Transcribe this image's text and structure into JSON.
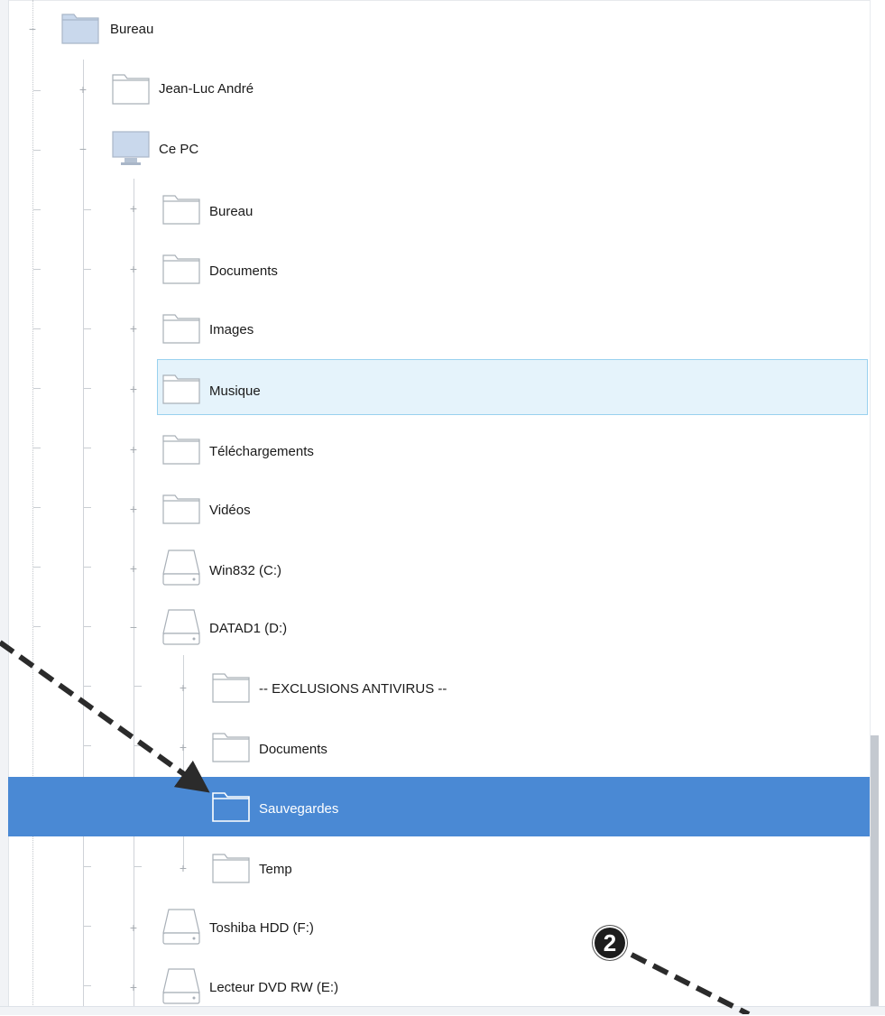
{
  "tree": {
    "items": [
      {
        "label": "Bureau",
        "icon": "folder-icon"
      },
      {
        "label": "Jean-Luc André",
        "icon": "folder-icon"
      },
      {
        "label": "Ce PC",
        "icon": "computer-icon"
      },
      {
        "label": "Bureau",
        "icon": "folder-icon"
      },
      {
        "label": "Documents",
        "icon": "folder-icon"
      },
      {
        "label": "Images",
        "icon": "folder-icon"
      },
      {
        "label": "Musique",
        "icon": "folder-icon"
      },
      {
        "label": "Téléchargements",
        "icon": "folder-icon"
      },
      {
        "label": "Vidéos",
        "icon": "folder-icon"
      },
      {
        "label": "Win832 (C:)",
        "icon": "drive-icon"
      },
      {
        "label": "DATAD1 (D:)",
        "icon": "drive-icon"
      },
      {
        "label": "-- EXCLUSIONS ANTIVIRUS --",
        "icon": "folder-icon"
      },
      {
        "label": "Documents",
        "icon": "folder-icon"
      },
      {
        "label": "Sauvegardes",
        "icon": "folder-icon"
      },
      {
        "label": "Temp",
        "icon": "folder-icon"
      },
      {
        "label": "Toshiba HDD (F:)",
        "icon": "drive-icon"
      },
      {
        "label": "Lecteur DVD RW (E:)",
        "icon": "drive-icon"
      }
    ],
    "hovered": "Musique",
    "selected": "Sauvegardes"
  },
  "annotation": {
    "badge": "2"
  },
  "colors": {
    "selection": "#4a89d4",
    "hover": "#e5f3fb",
    "hover_border": "#99d1ef",
    "icon_stroke": "#a9b0b8"
  }
}
